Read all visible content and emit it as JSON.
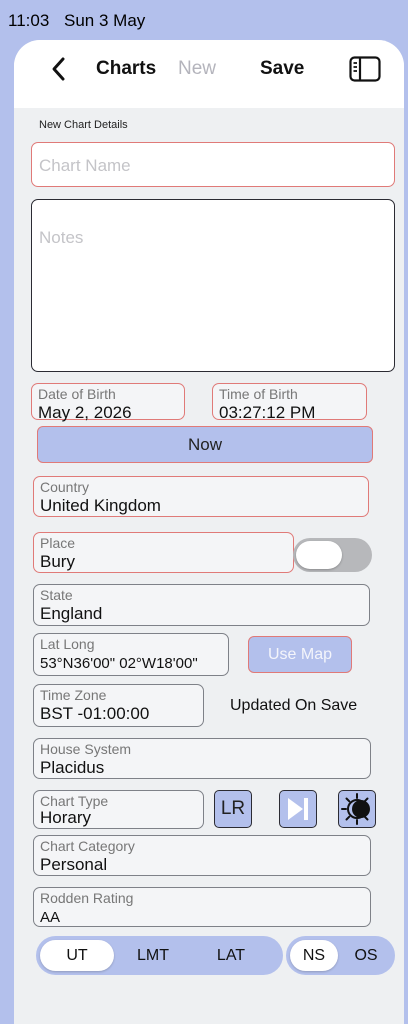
{
  "status": {
    "time": "11:03",
    "date": "Sun 3 May"
  },
  "nav": {
    "charts": "Charts",
    "new": "New",
    "save": "Save",
    "back_icon": "chevron-left-icon",
    "sidebar_icon": "sidebar-icon"
  },
  "section_title": "New Chart Details",
  "chart_name": {
    "placeholder": "Chart Name",
    "value": ""
  },
  "notes": {
    "placeholder": "Notes",
    "value": ""
  },
  "date_of_birth": {
    "label": "Date of Birth",
    "value": "May 2, 2026"
  },
  "time_of_birth": {
    "label": "Time of Birth",
    "value": "03:27:12 PM"
  },
  "now_button": "Now",
  "country": {
    "label": "Country",
    "value": "United Kingdom"
  },
  "place": {
    "label": "Place",
    "value": "Bury",
    "toggle_on": false
  },
  "state": {
    "label": "State",
    "value": "England"
  },
  "lat_long": {
    "label": "Lat Long",
    "value": "53°N36'00\" 02°W18'00\""
  },
  "use_map_button": "Use Map",
  "time_zone": {
    "label": "Time Zone",
    "value": "BST -01:00:00"
  },
  "updated_on_save": "Updated On Save",
  "house_system": {
    "label": "House System",
    "value": "Placidus"
  },
  "chart_type": {
    "label": "Chart Type",
    "value": "Horary"
  },
  "lr_button": "LR",
  "chart_category": {
    "label": "Chart Category",
    "value": "Personal"
  },
  "rodden_rating": {
    "label": "Rodden Rating",
    "value": "AA"
  },
  "time_segment": {
    "options": [
      "UT",
      "LMT",
      "LAT"
    ],
    "selected": "UT"
  },
  "ns_segment": {
    "options": [
      "NS",
      "OS"
    ],
    "selected": "NS"
  },
  "colors": {
    "accent": "#b3c0ec",
    "required_border": "#e07a78"
  }
}
